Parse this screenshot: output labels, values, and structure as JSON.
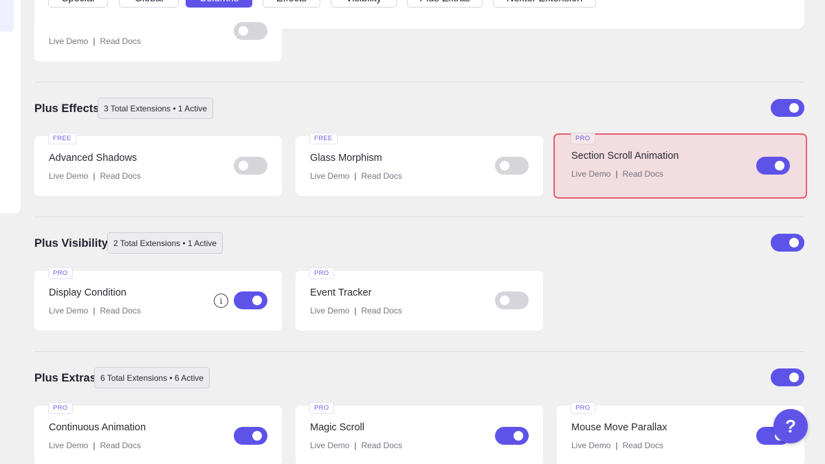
{
  "tabs": [
    {
      "label": "Special"
    },
    {
      "label": "Global"
    },
    {
      "label": "Columns",
      "active": true
    },
    {
      "label": "Effects"
    },
    {
      "label": "Visibility"
    },
    {
      "label": "Plus Extras"
    },
    {
      "label": "Nexter Extension"
    }
  ],
  "link_labels": {
    "demo": "Live Demo",
    "sep": "|",
    "docs": "Read Docs"
  },
  "partial_card": {
    "enabled": false
  },
  "sections": [
    {
      "title": "Plus Effects",
      "summary": "3 Total Extensions • 1 Active",
      "section_enabled": true,
      "cards": [
        {
          "badge": "FREE",
          "name": "Advanced Shadows",
          "enabled": false
        },
        {
          "badge": "FREE",
          "name": "Glass Morphism",
          "enabled": false
        },
        {
          "badge": "PRO",
          "name": "Section Scroll Animation",
          "enabled": true,
          "highlighted": true
        }
      ]
    },
    {
      "title": "Plus Visibility",
      "summary": "2 Total Extensions • 1 Active",
      "section_enabled": true,
      "cards": [
        {
          "badge": "PRO",
          "name": "Display Condition",
          "enabled": true,
          "info_icon": "i"
        },
        {
          "badge": "PRO",
          "name": "Event Tracker",
          "enabled": false
        }
      ]
    },
    {
      "title": "Plus Extras",
      "summary": "6 Total Extensions • 6 Active",
      "section_enabled": true,
      "cards": [
        {
          "badge": "PRO",
          "name": "Continuous Animation",
          "enabled": true
        },
        {
          "badge": "PRO",
          "name": "Magic Scroll",
          "enabled": true
        },
        {
          "badge": "PRO",
          "name": "Mouse Move Parallax",
          "enabled": true
        }
      ]
    }
  ],
  "help_button": {
    "label": "?"
  },
  "colors": {
    "accent": "#5e53e8",
    "highlight_border": "#ec5a6e",
    "highlight_bg": "#f2dde0",
    "toggle_off": "#d6d6da"
  }
}
